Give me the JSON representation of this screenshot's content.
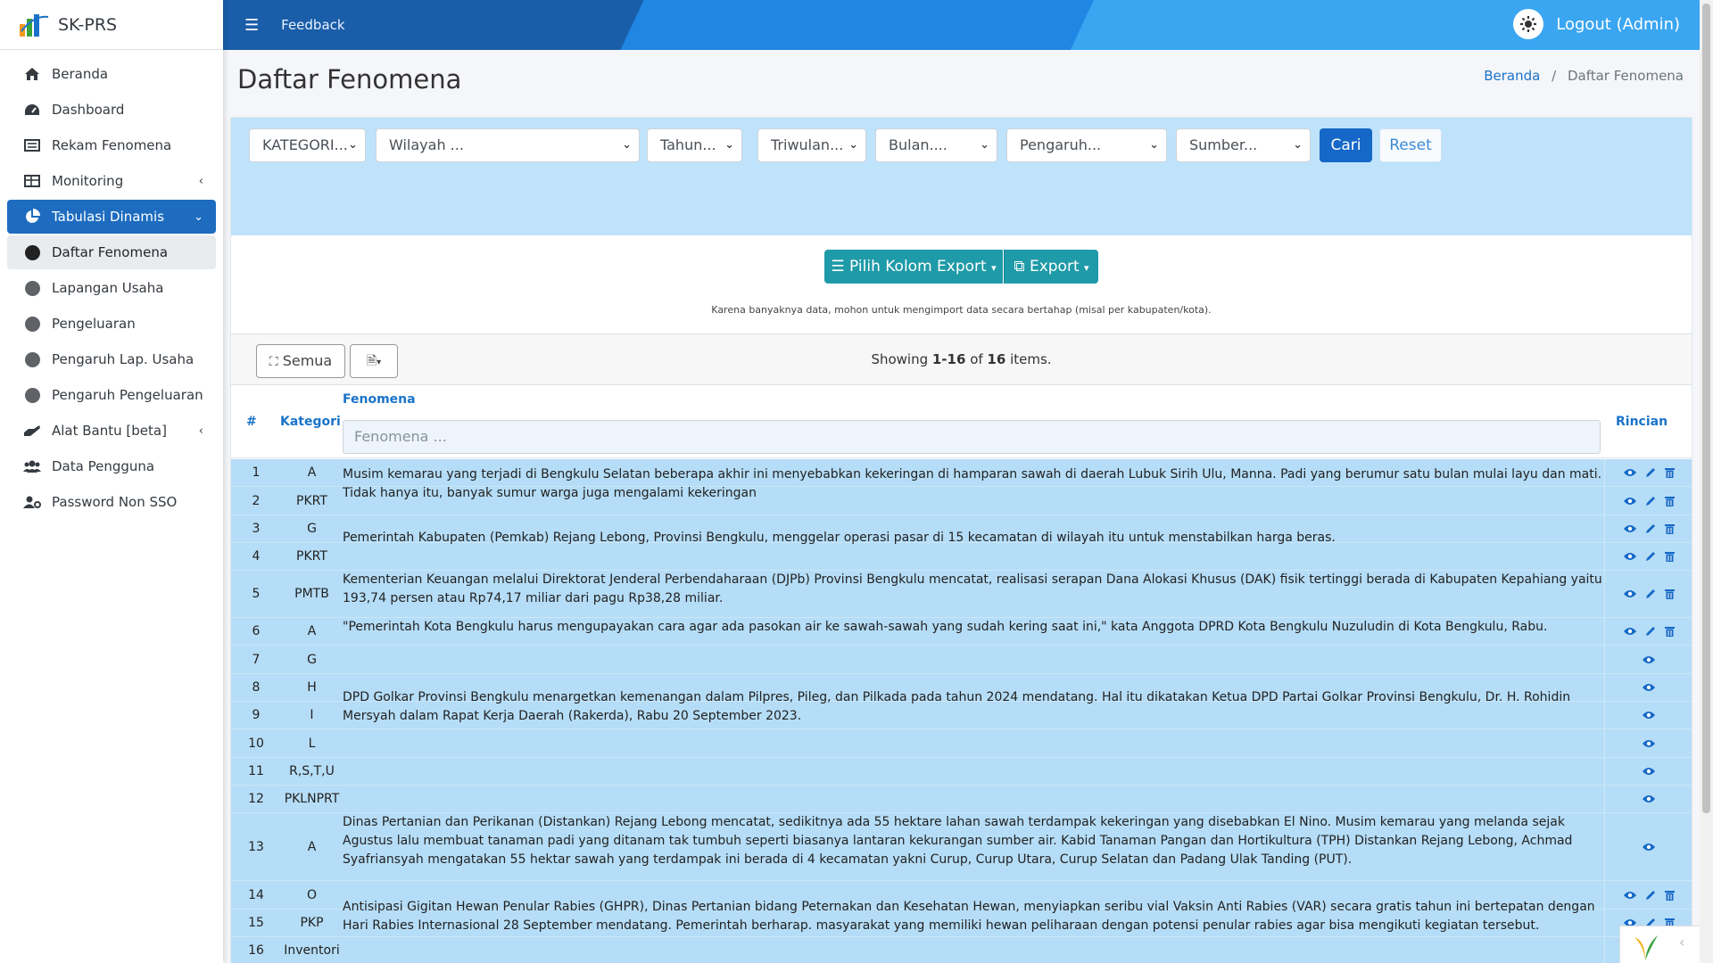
{
  "brand": {
    "name": "SK-PRS"
  },
  "topbar": {
    "feedback": "Feedback",
    "logout": "Logout (Admin)"
  },
  "sidebar": {
    "items": [
      {
        "label": "Beranda",
        "icon": "home-icon"
      },
      {
        "label": "Dashboard",
        "icon": "gauge-icon"
      },
      {
        "label": "Rekam Fenomena",
        "icon": "list-icon"
      },
      {
        "label": "Monitoring",
        "icon": "table-icon"
      },
      {
        "label": "Tabulasi Dinamis",
        "icon": "pie-chart-icon"
      },
      {
        "label": "Daftar Fenomena"
      },
      {
        "label": "Lapangan Usaha"
      },
      {
        "label": "Pengeluaran"
      },
      {
        "label": "Pengaruh Lap. Usaha"
      },
      {
        "label": "Pengaruh Pengeluaran"
      },
      {
        "label": "Alat Bantu [beta]",
        "icon": "hand-icon"
      },
      {
        "label": "Data Pengguna",
        "icon": "users-icon"
      },
      {
        "label": "Password Non SSO",
        "icon": "user-gear-icon"
      }
    ]
  },
  "page": {
    "title": "Daftar Fenomena",
    "breadcrumb_home": "Beranda",
    "breadcrumb_sep": "/",
    "breadcrumb_current": "Daftar Fenomena"
  },
  "filters": {
    "kategori": "KATEGORI...",
    "wilayah": "Wilayah ...",
    "tahun": "Tahun...",
    "triwulan": "Triwulan...",
    "bulan": "Bulan....",
    "pengaruh": "Pengaruh...",
    "sumber": "Sumber...",
    "cari": "Cari",
    "reset": "Reset"
  },
  "export": {
    "pilih_kolom": "Pilih Kolom Export",
    "export": "Export",
    "note": "Karena banyaknya data, mohon untuk mengimport data secara bertahap (misal per kabupaten/kota)."
  },
  "toolbar": {
    "semua": "Semua",
    "showing_prefix": "Showing ",
    "showing_range": "1-16",
    "showing_of": " of ",
    "showing_total": "16",
    "showing_suffix": " items."
  },
  "table": {
    "headers": {
      "no": "#",
      "kategori": "Kategori",
      "fenomena": "Fenomena",
      "rincian": "Rincian"
    },
    "fenomena_placeholder": "Fenomena ...",
    "rows": [
      {
        "no": "1",
        "kategori": "A",
        "actions": "full"
      },
      {
        "no": "2",
        "kategori": "PKRT",
        "actions": "full"
      },
      {
        "no": "3",
        "kategori": "G",
        "actions": "full"
      },
      {
        "no": "4",
        "kategori": "PKRT",
        "actions": "full"
      },
      {
        "no": "5",
        "kategori": "PMTB",
        "actions": "full"
      },
      {
        "no": "6",
        "kategori": "A",
        "actions": "full"
      },
      {
        "no": "7",
        "kategori": "G",
        "actions": "view"
      },
      {
        "no": "8",
        "kategori": "H",
        "actions": "view"
      },
      {
        "no": "9",
        "kategori": "I",
        "actions": "view"
      },
      {
        "no": "10",
        "kategori": "L",
        "actions": "view"
      },
      {
        "no": "11",
        "kategori": "R,S,T,U",
        "actions": "view"
      },
      {
        "no": "12",
        "kategori": "PKLNPRT",
        "actions": "view"
      },
      {
        "no": "13",
        "kategori": "A",
        "actions": "view"
      },
      {
        "no": "14",
        "kategori": "O",
        "actions": "full"
      },
      {
        "no": "15",
        "kategori": "PKP",
        "actions": "full"
      },
      {
        "no": "16",
        "kategori": "Inventori",
        "actions": "full"
      }
    ],
    "fenomena_texts": [
      "Musim kemarau yang terjadi di Bengkulu Selatan beberapa akhir ini menyebabkan kekeringan di hamparan sawah di daerah Lubuk Sirih Ulu, Manna. Padi yang berumur satu bulan mulai layu dan mati. Tidak hanya itu, banyak sumur warga juga mengalami kekeringan",
      "Pemerintah Kabupaten (Pemkab) Rejang Lebong, Provinsi Bengkulu, menggelar operasi pasar di 15 kecamatan di wilayah itu untuk menstabilkan harga beras.",
      "Kementerian Keuangan melalui Direktorat Jenderal Perbendaharaan (DJPb) Provinsi Bengkulu mencatat, realisasi serapan Dana Alokasi Khusus (DAK) fisik tertinggi berada di Kabupaten Kepahiang yaitu 193,74 persen atau Rp74,17 miliar dari pagu Rp38,28 miliar.",
      "\"Pemerintah Kota Bengkulu harus mengupayakan cara agar ada pasokan air ke sawah-sawah yang sudah kering saat ini,\" kata Anggota DPRD Kota Bengkulu Nuzuludin di Kota Bengkulu, Rabu.",
      "DPD Golkar Provinsi Bengkulu menargetkan kemenangan dalam Pilpres, Pileg, dan Pilkada pada tahun 2024 mendatang. Hal itu dikatakan Ketua DPD Partai Golkar Provinsi Bengkulu, Dr. H. Rohidin Mersyah dalam Rapat Kerja Daerah (Rakerda), Rabu 20 September 2023.",
      "Dinas Pertanian dan Perikanan (Distankan) Rejang Lebong mencatat, sedikitnya ada 55 hektare lahan sawah terdampak kekeringan yang disebabkan El Nino. Musim kemarau yang melanda sejak Agustus lalu membuat tanaman padi yang ditanam tak tumbuh seperti biasanya lantaran kekurangan sumber air. Kabid Tanaman Pangan dan Hortikultura (TPH) Distankan Rejang Lebong, Achmad Syafriansyah mengatakan 55 hektar sawah yang terdampak ini berada di 4 kecamatan yakni Curup, Curup Utara, Curup Selatan dan Padang Ulak Tanding (PUT).",
      "Antisipasi Gigitan Hewan Penular Rabies (GHPR), Dinas Pertanian bidang Peternakan dan Kesehatan Hewan, menyiapkan seribu vial Vaksin Anti Rabies (VAR) secara gratis tahun ini bertepatan dengan Hari Rabies Internasional 28 September mendatang. Pemerintah berharap. masyarakat yang memiliki hewan peliharaan dengan potensi penular rabies agar bisa mengikuti kegiatan tersebut."
    ]
  },
  "colors": {
    "primary": "#1568c7",
    "teal": "#1f9aa8",
    "row_bg": "#b5ddf7",
    "filter_bg": "#bfe3fb"
  }
}
